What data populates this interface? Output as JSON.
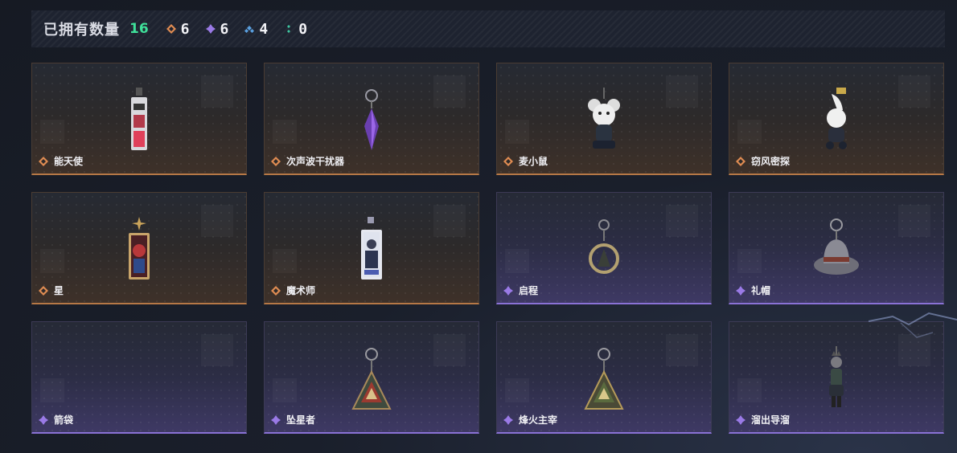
{
  "header": {
    "owned_label": "已拥有数量",
    "owned_count": "16",
    "stats": [
      {
        "rarity": "orange",
        "icon": "orange-diamond-icon",
        "color": "#e08c52",
        "value": "6"
      },
      {
        "rarity": "purple",
        "icon": "purple-diamond-icon",
        "color": "#9a7ae6",
        "value": "6"
      },
      {
        "rarity": "blue",
        "icon": "blue-diamond-icon",
        "color": "#5aa0e0",
        "value": "4"
      },
      {
        "rarity": "green",
        "icon": "green-diamond-icon",
        "color": "#3fc6a0",
        "value": "0"
      }
    ]
  },
  "items": [
    {
      "name": "能天使",
      "rarity": "orange",
      "icon": "tag-pendant-icon"
    },
    {
      "name": "次声波干扰器",
      "rarity": "orange",
      "icon": "crystal-pendant-icon"
    },
    {
      "name": "麦小鼠",
      "rarity": "orange",
      "icon": "mouse-pendant-icon"
    },
    {
      "name": "窃风密探",
      "rarity": "orange",
      "icon": "rabbit-pendant-icon"
    },
    {
      "name": "星",
      "rarity": "orange",
      "icon": "star-card-pendant-icon"
    },
    {
      "name": "魔术师",
      "rarity": "orange",
      "icon": "magician-card-pendant-icon"
    },
    {
      "name": "启程",
      "rarity": "purple",
      "icon": "ring-pendant-icon"
    },
    {
      "name": "礼帽",
      "rarity": "purple",
      "icon": "hat-pendant-icon"
    },
    {
      "name": "箭袋",
      "rarity": "purple",
      "icon": ""
    },
    {
      "name": "坠星者",
      "rarity": "purple",
      "icon": "triangle-pendant-icon"
    },
    {
      "name": "烽火主宰",
      "rarity": "purple",
      "icon": "triangle-pendant-icon"
    },
    {
      "name": "溜出导溜",
      "rarity": "purple",
      "icon": "figure-pendant-icon"
    }
  ],
  "colors": {
    "orange": "#e08c52",
    "purple": "#9a7ae6",
    "count_green": "#3fe09a"
  }
}
